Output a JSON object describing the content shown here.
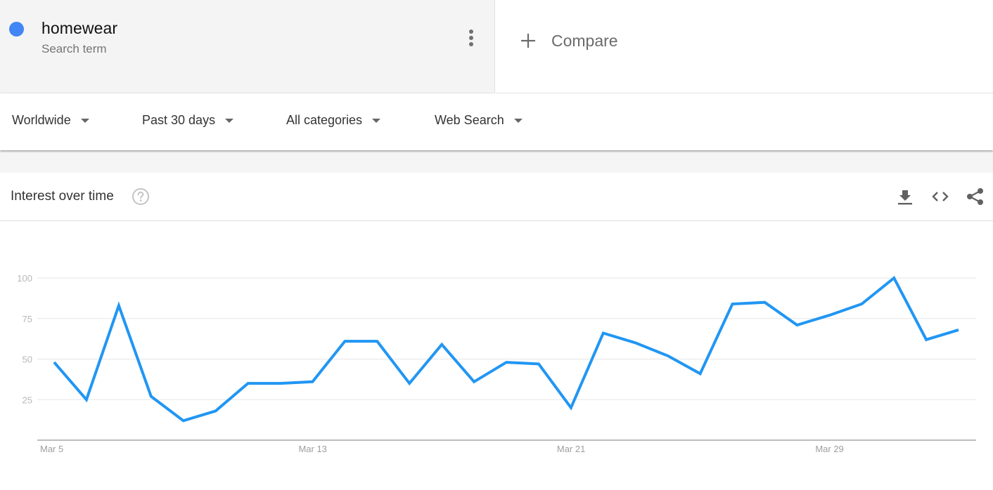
{
  "term": {
    "name": "homewear",
    "subtitle": "Search term",
    "color": "#4285f4",
    "menu_icon": "more-vert-icon"
  },
  "compare": {
    "label": "Compare",
    "icon": "plus-icon"
  },
  "filters": [
    {
      "label": "Worldwide"
    },
    {
      "label": "Past 30 days"
    },
    {
      "label": "All categories"
    },
    {
      "label": "Web Search"
    }
  ],
  "card": {
    "title": "Interest over time",
    "help_icon": "help-circle-icon",
    "actions": [
      {
        "name": "download",
        "icon": "download-icon"
      },
      {
        "name": "embed",
        "icon": "code-icon"
      },
      {
        "name": "share",
        "icon": "share-icon"
      }
    ]
  },
  "chart_data": {
    "type": "line",
    "title": "Interest over time",
    "xlabel": "",
    "ylabel": "",
    "ylim": [
      0,
      100
    ],
    "yticks": [
      25,
      50,
      75,
      100
    ],
    "grid": true,
    "legend": "none",
    "x_tick_labels": [
      {
        "index": 0,
        "label": "Mar 5"
      },
      {
        "index": 8,
        "label": "Mar 13"
      },
      {
        "index": 16,
        "label": "Mar 21"
      },
      {
        "index": 24,
        "label": "Mar 29"
      }
    ],
    "x": [
      "Mar 5",
      "Mar 6",
      "Mar 7",
      "Mar 8",
      "Mar 9",
      "Mar 10",
      "Mar 11",
      "Mar 12",
      "Mar 13",
      "Mar 14",
      "Mar 15",
      "Mar 16",
      "Mar 17",
      "Mar 18",
      "Mar 19",
      "Mar 20",
      "Mar 21",
      "Mar 22",
      "Mar 23",
      "Mar 24",
      "Mar 25",
      "Mar 26",
      "Mar 27",
      "Mar 28",
      "Mar 29",
      "Mar 30",
      "Mar 31",
      "Apr 1",
      "Apr 2"
    ],
    "series": [
      {
        "name": "homewear",
        "color": "#2196f3",
        "values": [
          48,
          25,
          83,
          27,
          12,
          18,
          35,
          35,
          36,
          61,
          61,
          35,
          59,
          36,
          48,
          47,
          20,
          66,
          60,
          52,
          41,
          84,
          85,
          71,
          77,
          84,
          100,
          62,
          68
        ]
      }
    ]
  }
}
